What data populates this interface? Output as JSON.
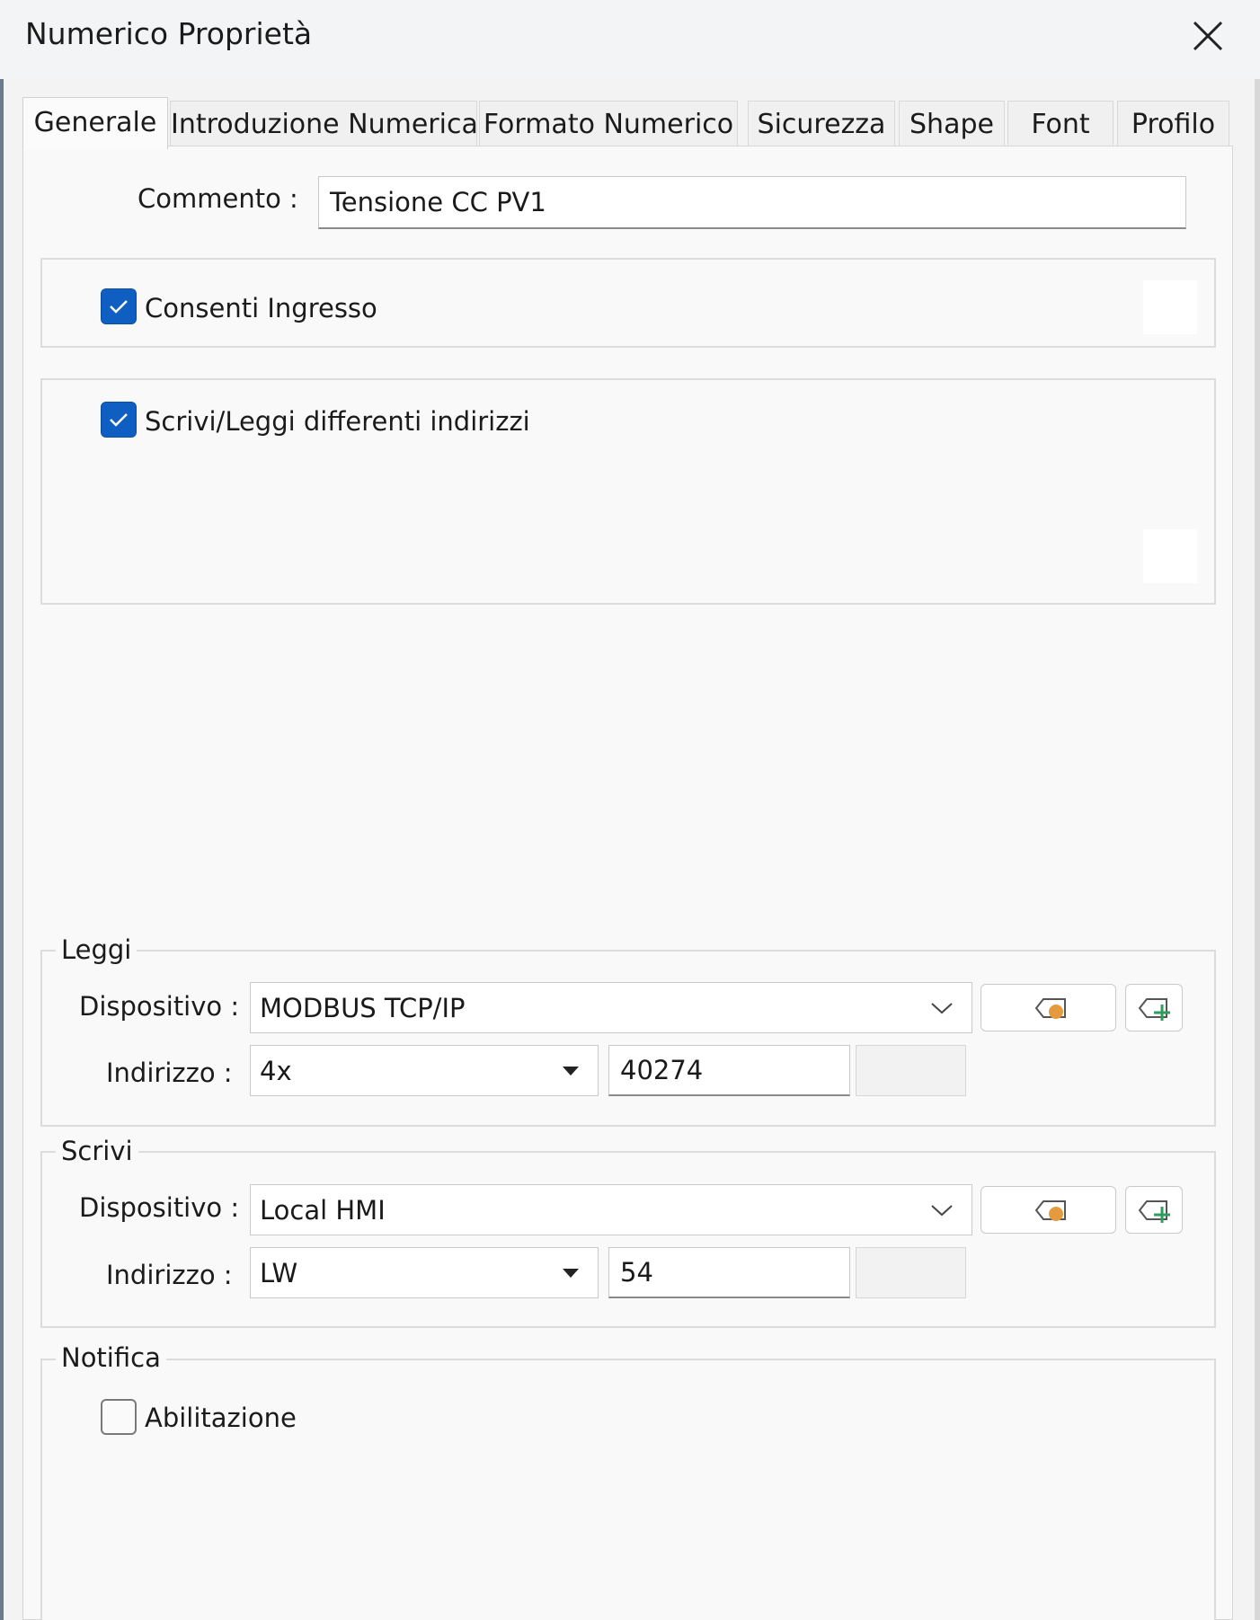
{
  "window": {
    "title": "Numerico Proprietà"
  },
  "tabs": [
    {
      "label": "Generale",
      "active": true
    },
    {
      "label": "Introduzione Numerica"
    },
    {
      "label": "Formato Numerico"
    },
    {
      "label": "Sicurezza"
    },
    {
      "label": "Shape"
    },
    {
      "label": "Font"
    },
    {
      "label": "Profilo"
    }
  ],
  "general": {
    "comment_label": "Commento :",
    "comment_value": "Tensione CC PV1",
    "allow_input": {
      "label": "Consenti Ingresso",
      "checked": true
    },
    "different_addresses": {
      "label": "Scrivi/Leggi differenti indirizzi",
      "checked": true
    }
  },
  "read": {
    "title": "Leggi",
    "device_label": "Dispositivo :",
    "device_value": "MODBUS TCP/IP",
    "address_label": "Indirizzo :",
    "address_type": "4x",
    "address_value": "40274"
  },
  "write": {
    "title": "Scrivi",
    "device_label": "Dispositivo :",
    "device_value": "Local HMI",
    "address_label": "Indirizzo :",
    "address_type": "LW",
    "address_value": "54"
  },
  "notify": {
    "title": "Notifica",
    "enable": {
      "label": "Abilitazione",
      "checked": false
    }
  },
  "colors": {
    "accent": "#0f5fc2",
    "tag_dot": "#e59b3d",
    "tag_plus": "#2e9e5b"
  },
  "icons": {
    "close": "close-icon",
    "check": "check-icon",
    "tag": "tag-icon",
    "add_tag": "add-tag-icon",
    "dropdown": "chevron-down-icon"
  }
}
